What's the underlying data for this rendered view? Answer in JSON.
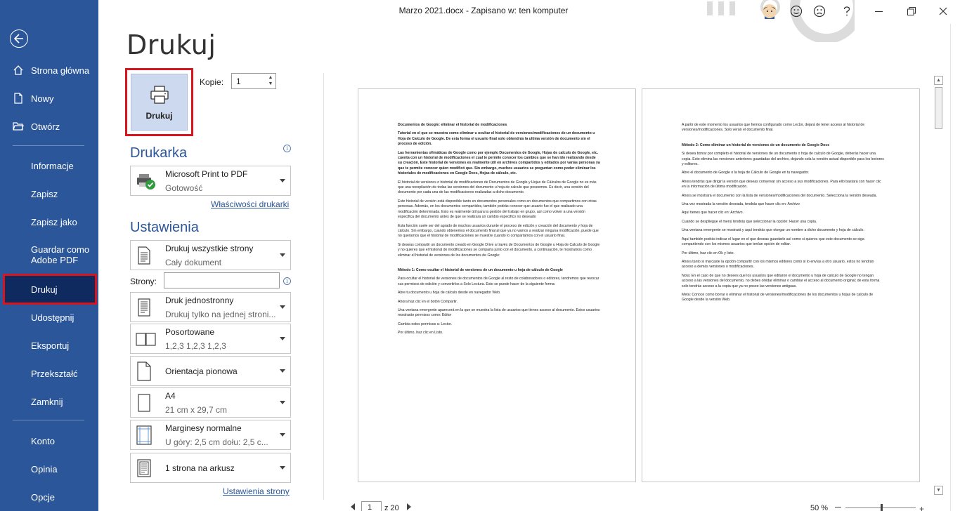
{
  "window": {
    "title": "Marzo 2021.docx  -  Zapisano w: ten komputer"
  },
  "sidebar": {
    "items": [
      {
        "label": "Strona główna",
        "icon": "home-icon"
      },
      {
        "label": "Nowy",
        "icon": "new-document-icon"
      },
      {
        "label": "Otwórz",
        "icon": "folder-open-icon"
      },
      {
        "label": "Informacje"
      },
      {
        "label": "Zapisz"
      },
      {
        "label": "Zapisz jako"
      },
      {
        "label": "Guardar como Adobe PDF"
      },
      {
        "label": "Drukuj"
      },
      {
        "label": "Udostępnij"
      },
      {
        "label": "Eksportuj"
      },
      {
        "label": "Przekształć"
      },
      {
        "label": "Zamknij"
      },
      {
        "label": "Konto"
      },
      {
        "label": "Opinia"
      },
      {
        "label": "Opcje"
      }
    ],
    "active": "Drukuj"
  },
  "print": {
    "title": "Drukuj",
    "button_label": "Drukuj",
    "copies_label": "Kopie:",
    "copies_value": "1"
  },
  "printer": {
    "heading": "Drukarka",
    "name": "Microsoft Print to PDF",
    "status": "Gotowość",
    "properties_link": "Właściwości drukarki"
  },
  "settings": {
    "heading": "Ustawienia",
    "range": {
      "line1": "Drukuj wszystkie strony",
      "line2": "Cały dokument"
    },
    "pages_label": "Strony:",
    "pages_value": "",
    "sides": {
      "line1": "Druk jednostronny",
      "line2": "Drukuj tylko na jednej stroni..."
    },
    "collate": {
      "line1": "Posortowane",
      "line2": "1,2,3    1,2,3    1,2,3"
    },
    "orientation": "Orientacja pionowa",
    "paper": {
      "line1": "A4",
      "line2": "21  cm x 29,7  cm"
    },
    "margins": {
      "line1": "Marginesy normalne",
      "line2": "U góry: 2,5  cm dołu: 2,5  c..."
    },
    "per_sheet": "1 strona na arkusz",
    "page_setup_link": "Ustawienia strony"
  },
  "preview": {
    "page1": [
      {
        "bold": true,
        "text": "Documentos de Google: eliminar el historial de modificaciones"
      },
      {
        "bold": true,
        "text": "Tutorial en el que se muestra como eliminar u ocultar el historial de versiones/modificaciones de un documento u Hoja de Calculo de Google. De esta forma el usuario final solo obtendrás la ultima versión de documento sin el proceso de edición."
      },
      {
        "bold": true,
        "text": "Las herramientas ofimáticas de Google como por ejemplo Documentos de Google, Hojas de calculo de Google, etc. cuenta con un historial de modificaciones el cual te permite conocer los cambios que se han ido realizando desde su creación. Este historial de versiones es realmente útil en archivos compartidos y editados por varias personas ya que te permite conocer quien modificó que. Sin embargo, muchos usuarios se preguntan como poder eliminar los historiales de modificaciones en Google Docs, Hojas de cálculo, etc."
      },
      {
        "bold": false,
        "text": "El historial de versiones o historial de modificaciones de Documentos de Google y Hojas de Cálculos de Google no es más que una recopilación de todas las versiones del documento u hoja de calculo que poseemos. Es decir, una versión del documento por cada una de las modificaciones realizadas a dicho documento."
      },
      {
        "bold": false,
        "text": "Este historial de versión está disponible tanto en documentos personales como en documentos que compartimos con otras personas. Además, en los documentos compartidos, también podrás conocer que usuario fue el que realizado una modificación determinada. Esto es realmente útil para la gestión del trabajo en grupo, así como volver a una versión especifica del documento antes de que se realizara un cambio especifico no deseado"
      },
      {
        "bold": false,
        "text": "Esta función suele ser del agrado de muchos usuarios durante el proceso de edición y creación del documento y hoja de cálculo. Sin embargo, cuando obtenemos el documento final al que ya no vamos a realizar ninguna modificación, puede que no queramos que el historial de modificaciones se muestre cuando lo compartamos con el usuario final."
      },
      {
        "bold": false,
        "text": "Si deseas compartir un documento creado en Google Drive a través de Documentos de Google u Hoja de Calculo de Google y no quieres que el historial de modificaciones se comparta junto con el documento, a continuación, te mostramos como eliminar el historial de versiones de los documentos de Google:"
      },
      {
        "bold": true,
        "text": "Método 1: Como ocultar el historial de versiones de un documento u hoja de cálculo de Google"
      },
      {
        "bold": false,
        "text": "Para ocultar el historial de versiones de documentos de Google al resto de colaboradores o editores, tendremos que revocar sus permisos de edición y convertirlos a Solo Lectura. Esto se puede hacer de la siguiente forma:"
      },
      {
        "bold": false,
        "text": "Abre tu documento u hoja de cálculo desde en navegador Web."
      },
      {
        "bold": false,
        "text": "Ahora haz clic en el botón Compartir."
      },
      {
        "bold": false,
        "text": "Una ventana emergente aparecerá en la que se muestra la lista de usuarios que tienes acceso al documento. Estos usuarios mostrarán permisos como: Editor"
      },
      {
        "bold": false,
        "text": "Cambia estos permisos a: Lector."
      },
      {
        "bold": false,
        "text": "Por último, haz clic en Listo."
      }
    ],
    "page2": [
      {
        "bold": false,
        "text": "A partir de este momento los usuarios que hemos configurado como Lector, dejará de tener acceso al historial de versiones/modificaciones. Solo verán el documento final."
      },
      {
        "bold": true,
        "text": "Método 2: Como eliminar un historial de versiones de un documento de Google Docs"
      },
      {
        "bold": false,
        "text": "Si desea borrar por completo el historial de versiones de un documento o hoja de calculo de Google, deberás hacer una copia. Esto elimina las versiones anteriores guardadas del archivo, dejando sola la versión actual disponible para los lectores y editores."
      },
      {
        "bold": false,
        "text": "Abre el documento de Google o la hoja de Cálculo de Google en tu navegador."
      },
      {
        "bold": false,
        "text": "Ahora tendrás que dirigir la versión que deseas conservar sin acceso a sus modificaciones. Para ello bastará con hacer clic en la información de última modificación."
      },
      {
        "bold": false,
        "text": "Ahora se mostrará el documento con la lista de versiones/modificaciones del documento. Selecciona la versión deseada."
      },
      {
        "bold": false,
        "text": "Una vez mostrada la versión deseada, tendrás que hacer clic en: Archivo"
      },
      {
        "bold": false,
        "text": "Aquí tienes que hacer clic en: Archivo."
      },
      {
        "bold": false,
        "text": "Cuando se despliegue el menú tendrás que seleccionar la opción: Hacer una copia."
      },
      {
        "bold": false,
        "text": "Una ventana emergente se mostrará y aquí tendrás que otorgar un nombre a dicho documento y hoja de cálculo."
      },
      {
        "bold": false,
        "text": "Aquí también podrás indicar el lugar en el que deseas guardarlo así como si quieres que este documento se siga compartiendo con los mismos usuarios que tenían opción de editar."
      },
      {
        "bold": false,
        "text": "Por último, haz clic en Ok y listo."
      },
      {
        "bold": false,
        "text": "Ahora tanto si marcaste la opción compartir con los mismos editores como si lo envías a otro usuario, estos no tendrán acceso a demás versiones o modificaciones."
      },
      {
        "bold": false,
        "text": "Nota: En el caso de que no desees que los usuarios que editaron el documento u hoja de calculo de Google no tengan acceso a las versiones del documento, no debes olvidar eliminar o cambiar el acceso al documento original; de esta forma solo tendrás acceso a la copia que ya no posee las versiones antiguas."
      },
      {
        "bold": false,
        "text": "Meta: Conoce como borrar o eliminar el historial de versiones/modificaciones de los documentos u hojas de calculo de Google desde la versión Web."
      }
    ]
  },
  "bottom": {
    "page_value": "1",
    "page_of": "z 20",
    "zoom": "50 %"
  }
}
